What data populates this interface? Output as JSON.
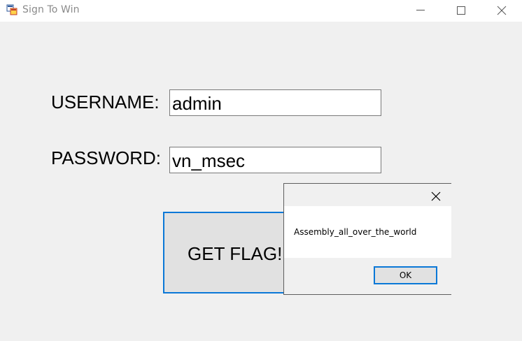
{
  "window": {
    "title": "Sign To Win",
    "icon": "winforms-app-icon"
  },
  "titlebar_buttons": {
    "minimize_icon": "minimize-icon",
    "maximize_icon": "maximize-icon",
    "close_icon": "close-icon"
  },
  "form": {
    "username_label": "USERNAME:",
    "username_value": "admin",
    "password_label": "PASSWORD:",
    "password_value": "vn_msec",
    "submit_label": "GET FLAG!"
  },
  "message_box": {
    "text": "Assembly_all_over_the_world",
    "ok_label": "OK",
    "close_icon": "close-icon"
  },
  "colors": {
    "accent_border": "#0a78d7",
    "window_bg": "#f0f0f0",
    "button_bg": "#e1e1e1"
  }
}
